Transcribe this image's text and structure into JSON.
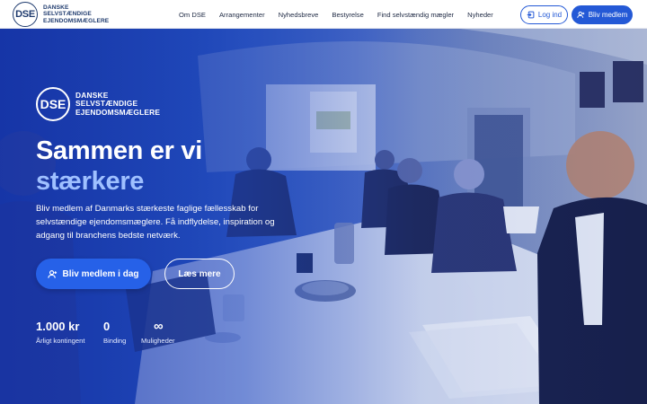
{
  "brand": {
    "mark": "DSE",
    "name_lines": [
      "DANSKE",
      "SELVSTÆNDIGE",
      "EJENDOMSMÆGLERE"
    ]
  },
  "nav": {
    "links": [
      "Om DSE",
      "Arrangementer",
      "Nyhedsbreve",
      "Bestyrelse",
      "Find selvstændig mægler",
      "Nyheder"
    ],
    "login_label": "Log ind",
    "member_label": "Bliv medlem"
  },
  "hero": {
    "title_line1": "Sammen er vi",
    "title_line2": "stærkere",
    "lead": "Bliv medlem af Danmarks stærkeste faglige fællesskab for selvstændige ejendomsmæglere. Få indflydelse, inspiration og adgang til branchens bedste netværk.",
    "cta_primary": "Bliv medlem i dag",
    "cta_secondary": "Læs mere",
    "stats": [
      {
        "value": "1.000 kr",
        "label": "Årligt kontingent"
      },
      {
        "value": "0",
        "label": "Binding"
      },
      {
        "value": "∞",
        "label": "Muligheder"
      }
    ]
  },
  "colors": {
    "brand_navy": "#1f3b6e",
    "accent_blue": "#2459d6",
    "title_accent": "#9fc0ff"
  },
  "icons": [
    "user-plus-icon",
    "login-icon"
  ]
}
